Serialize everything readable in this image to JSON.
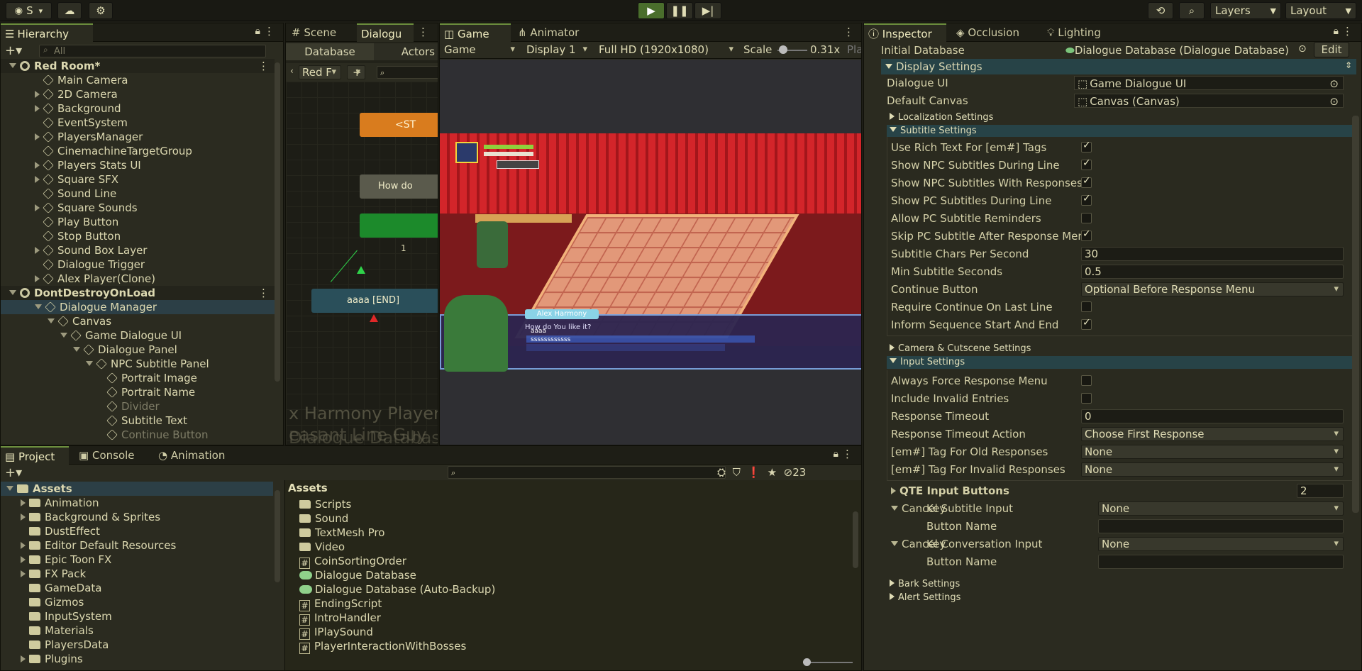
{
  "toolbar": {
    "account_label": "S",
    "layers_label": "Layers",
    "layout_label": "Layout"
  },
  "hierarchy": {
    "tab": "Hierarchy",
    "search_placeholder": "All",
    "items": [
      {
        "label": "Red Room*",
        "depth": 0,
        "type": "scene",
        "expanded": true
      },
      {
        "label": "Main Camera",
        "depth": 1,
        "type": "obj"
      },
      {
        "label": "2D Camera",
        "depth": 1,
        "type": "obj",
        "fold": true
      },
      {
        "label": "Background",
        "depth": 1,
        "type": "obj",
        "fold": true
      },
      {
        "label": "EventSystem",
        "depth": 1,
        "type": "obj"
      },
      {
        "label": "PlayersManager",
        "depth": 1,
        "type": "obj",
        "fold": true
      },
      {
        "label": "CinemachineTargetGroup",
        "depth": 1,
        "type": "obj"
      },
      {
        "label": "Players Stats UI",
        "depth": 1,
        "type": "obj",
        "fold": true
      },
      {
        "label": "Square SFX",
        "depth": 1,
        "type": "obj",
        "fold": true
      },
      {
        "label": "Sound Line",
        "depth": 1,
        "type": "obj"
      },
      {
        "label": "Square Sounds",
        "depth": 1,
        "type": "obj",
        "fold": true
      },
      {
        "label": "Play Button",
        "depth": 1,
        "type": "obj"
      },
      {
        "label": "Stop Button",
        "depth": 1,
        "type": "obj"
      },
      {
        "label": "Sound Box Layer",
        "depth": 1,
        "type": "obj",
        "fold": true
      },
      {
        "label": "Dialogue Trigger",
        "depth": 1,
        "type": "obj"
      },
      {
        "label": "Alex Player(Clone)",
        "depth": 1,
        "type": "obj",
        "fold": true
      },
      {
        "label": "DontDestroyOnLoad",
        "depth": 0,
        "type": "scene",
        "expanded": true
      },
      {
        "label": "Dialogue Manager",
        "depth": 1,
        "type": "obj",
        "expanded": true,
        "selected": true
      },
      {
        "label": "Canvas",
        "depth": 2,
        "type": "obj",
        "expanded": true
      },
      {
        "label": "Game Dialogue UI",
        "depth": 3,
        "type": "obj",
        "expanded": true
      },
      {
        "label": "Dialogue Panel",
        "depth": 4,
        "type": "obj",
        "expanded": true
      },
      {
        "label": "NPC Subtitle Panel",
        "depth": 5,
        "type": "obj",
        "expanded": true
      },
      {
        "label": "Portrait Image",
        "depth": 6,
        "type": "obj"
      },
      {
        "label": "Portrait Name",
        "depth": 6,
        "type": "obj"
      },
      {
        "label": "Divider",
        "depth": 6,
        "type": "obj",
        "dim": true
      },
      {
        "label": "Subtitle Text",
        "depth": 6,
        "type": "obj"
      },
      {
        "label": "Continue Button",
        "depth": 6,
        "type": "obj",
        "dim": true
      }
    ]
  },
  "scene_tabs": {
    "scene": "Scene",
    "dialogue": "Dialogu"
  },
  "dialogue_editor": {
    "database_tab": "Database",
    "actors_tab": "Actors",
    "conversation": "Red F",
    "nodes": [
      "<ST",
      "How do",
      "aaaa [END]"
    ],
    "link_label": "1",
    "watermark1": "x Harmony Player",
    "watermark2": "Dialogue Database",
    "watermark3": "easant Line Guy"
  },
  "game": {
    "tab": "Game",
    "animator_tab": "Animator",
    "display_mode": "Game",
    "display": "Display 1",
    "resolution": "Full HD (1920x1080)",
    "scale_label": "Scale",
    "scale_value": "0.31x",
    "play_label": "Pla",
    "speaker": "Alex Harmony",
    "line1": "How do You like it?",
    "line2": "aaaa",
    "line3": "ssssssssssss"
  },
  "inspector": {
    "tabs": [
      "Inspector",
      "Occlusion",
      "Lighting"
    ],
    "initial_database_label": "Initial Database",
    "initial_database_value": "Dialogue Database (Dialogue Database)",
    "edit_label": "Edit",
    "display_settings": "Display Settings",
    "dialogue_ui_label": "Dialogue UI",
    "dialogue_ui_value": "Game Dialogue UI",
    "default_canvas_label": "Default Canvas",
    "default_canvas_value": "Canvas (Canvas)",
    "localization": "Localization Settings",
    "subtitle_settings": "Subtitle Settings",
    "subtitle": [
      {
        "label": "Use Rich Text For [em#] Tags",
        "kind": "check",
        "on": true
      },
      {
        "label": "Show NPC Subtitles During Line",
        "kind": "check",
        "on": true
      },
      {
        "label": "Show NPC Subtitles With Responses",
        "kind": "check",
        "on": true
      },
      {
        "label": "Show PC Subtitles During Line",
        "kind": "check",
        "on": true
      },
      {
        "label": "Allow PC Subtitle Reminders",
        "kind": "check",
        "on": false
      },
      {
        "label": "Skip PC Subtitle After Response Menu",
        "kind": "check",
        "on": true
      },
      {
        "label": "Subtitle Chars Per Second",
        "kind": "field",
        "value": "30"
      },
      {
        "label": "Min Subtitle Seconds",
        "kind": "field",
        "value": "0.5"
      },
      {
        "label": "Continue Button",
        "kind": "drop",
        "value": "Optional Before Response Menu"
      },
      {
        "label": "Require Continue On Last Line",
        "kind": "check",
        "on": false
      },
      {
        "label": "Inform Sequence Start And End",
        "kind": "check",
        "on": true
      }
    ],
    "camera": "Camera & Cutscene Settings",
    "input_settings": "Input Settings",
    "input": [
      {
        "label": "Always Force Response Menu",
        "kind": "check",
        "on": false
      },
      {
        "label": "Include Invalid Entries",
        "kind": "check",
        "on": false
      },
      {
        "label": "Response Timeout",
        "kind": "field",
        "value": "0"
      },
      {
        "label": "Response Timeout Action",
        "kind": "drop",
        "value": "Choose First Response"
      },
      {
        "label": "[em#] Tag For Old Responses",
        "kind": "drop",
        "value": "None"
      },
      {
        "label": "[em#] Tag For Invalid Responses",
        "kind": "drop",
        "value": "None"
      }
    ],
    "qte_label": "QTE Input Buttons",
    "qte_value": "2",
    "cancel_subtitle": "Cancel Subtitle Input",
    "cancel_conversation": "Cancel Conversation Input",
    "key_label": "Key",
    "key_value": "None",
    "button_name_label": "Button Name",
    "bark": "Bark Settings",
    "alert": "Alert Settings"
  },
  "project": {
    "tabs": [
      "Project",
      "Console",
      "Animation"
    ],
    "hidden_count": "23",
    "tree": [
      {
        "label": "Assets",
        "depth": 0,
        "expanded": true,
        "selected": true
      },
      {
        "label": "Animation",
        "depth": 1,
        "fold": true
      },
      {
        "label": "Background & Sprites",
        "depth": 1,
        "fold": true
      },
      {
        "label": "DustEffect",
        "depth": 1
      },
      {
        "label": "Editor Default Resources",
        "depth": 1,
        "fold": true
      },
      {
        "label": "Epic Toon FX",
        "depth": 1,
        "fold": true
      },
      {
        "label": "FX Pack",
        "depth": 1,
        "fold": true
      },
      {
        "label": "GameData",
        "depth": 1
      },
      {
        "label": "Gizmos",
        "depth": 1
      },
      {
        "label": "InputSystem",
        "depth": 1
      },
      {
        "label": "Materials",
        "depth": 1
      },
      {
        "label": "PlayersData",
        "depth": 1
      },
      {
        "label": "Plugins",
        "depth": 1,
        "fold": true
      }
    ],
    "assets_header": "Assets",
    "files": [
      {
        "label": "Scripts",
        "type": "folder"
      },
      {
        "label": "Sound",
        "type": "folder"
      },
      {
        "label": "TextMesh Pro",
        "type": "folder"
      },
      {
        "label": "Video",
        "type": "folder"
      },
      {
        "label": "CoinSortingOrder",
        "type": "script"
      },
      {
        "label": "Dialogue Database",
        "type": "db"
      },
      {
        "label": "Dialogue Database (Auto-Backup)",
        "type": "db"
      },
      {
        "label": "EndingScript",
        "type": "script"
      },
      {
        "label": "IntroHandler",
        "type": "script"
      },
      {
        "label": "IPlaySound",
        "type": "script"
      },
      {
        "label": "PlayerInteractionWithBosses",
        "type": "script"
      }
    ]
  }
}
